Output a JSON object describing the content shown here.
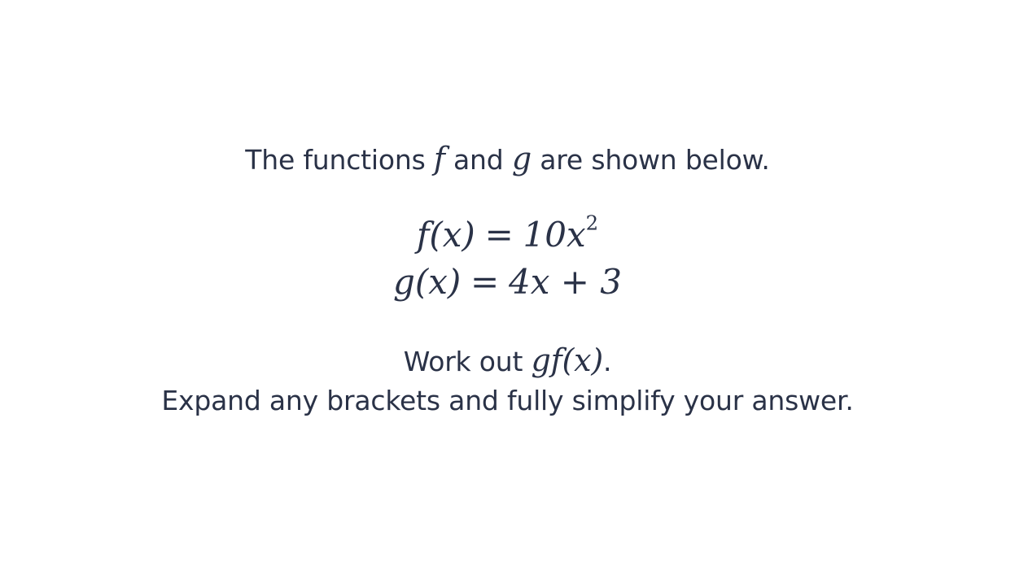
{
  "question": {
    "intro": {
      "before": "The functions",
      "f": "f",
      "and": "and",
      "g": "g",
      "after": "are shown below."
    },
    "equations": [
      {
        "lhs": "f(x)",
        "eq": "=",
        "rhs_coef": "10x",
        "rhs_exp": "2",
        "rhs_tail": ""
      },
      {
        "lhs": "g(x)",
        "eq": "=",
        "rhs_coef": "4x + 3",
        "rhs_exp": "",
        "rhs_tail": ""
      }
    ],
    "task": {
      "prefix": "Work out",
      "expression": "gf(x)",
      "suffix": "."
    },
    "instruction": "Expand any brackets and fully simplify your answer."
  }
}
